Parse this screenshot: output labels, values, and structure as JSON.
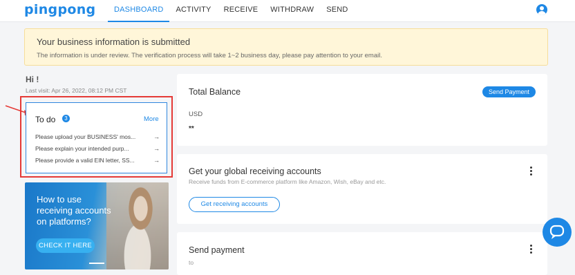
{
  "brand": {
    "name": "pingpong",
    "accent": "#1e88e5"
  },
  "nav": {
    "items": [
      {
        "label": "DASHBOARD",
        "active": true
      },
      {
        "label": "ACTIVITY"
      },
      {
        "label": "RECEIVE"
      },
      {
        "label": "WITHDRAW"
      },
      {
        "label": "SEND"
      }
    ],
    "avatar_icon": "user-icon"
  },
  "notice": {
    "title": "Your business information is submitted",
    "text": "The information is under review. The verification process will take 1~2 business day, please pay attention to your email."
  },
  "greeting": {
    "hi": "Hi !",
    "last_visit": "Last visit: Apr 26, 2022, 08:12 PM CST"
  },
  "todo": {
    "title": "To do",
    "count": "3",
    "more": "More",
    "items": [
      {
        "label": "Please upload your BUSINESS' mos..."
      },
      {
        "label": "Please explain your intended purp..."
      },
      {
        "label": "Please provide a valid EIN letter, SS..."
      }
    ]
  },
  "promo": {
    "headline": "How to use receiving accounts on platforms?",
    "button": "CHECK IT HERE"
  },
  "balance": {
    "title": "Total Balance",
    "send_button": "Send Payment",
    "currency": "USD",
    "amount": "**"
  },
  "receive": {
    "title": "Get your global receiving accounts",
    "subtitle": "Receive funds from E-commerce platform like Amazon, Wish, eBay and etc.",
    "button": "Get receiving accounts"
  },
  "send": {
    "title": "Send payment",
    "subtitle": "to"
  },
  "annotation": {
    "color": "#e53935"
  }
}
